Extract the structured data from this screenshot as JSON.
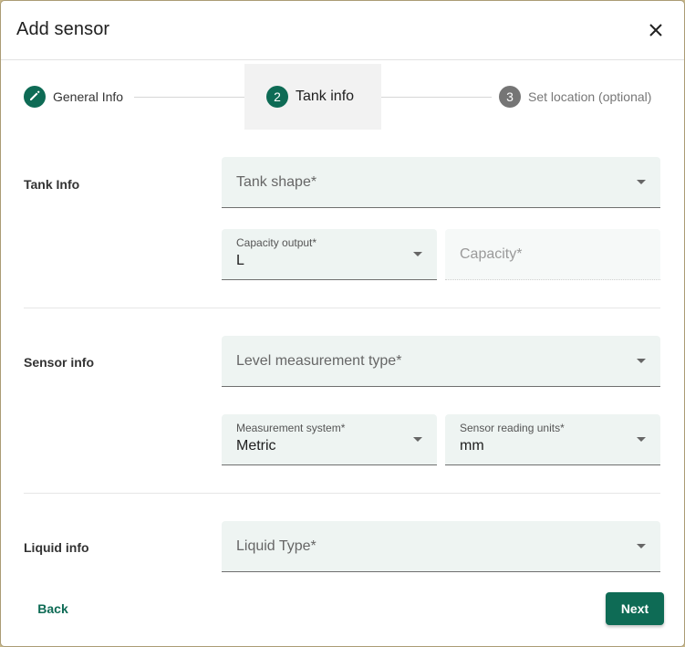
{
  "dialog": {
    "title": "Add sensor",
    "close_icon": "close-icon"
  },
  "stepper": {
    "steps": [
      {
        "number": "1",
        "label": "General Info",
        "icon": "pencil-icon",
        "state": "completed"
      },
      {
        "number": "2",
        "label": "Tank info",
        "state": "active"
      },
      {
        "number": "3",
        "label": "Set location (optional)",
        "state": "upcoming"
      }
    ]
  },
  "sections": {
    "tank": {
      "label": "Tank Info",
      "tank_shape": {
        "placeholder": "Tank shape*"
      },
      "capacity_output": {
        "label": "Capacity output*",
        "value": "L"
      },
      "capacity": {
        "placeholder": "Capacity*",
        "disabled": true
      }
    },
    "sensor": {
      "label": "Sensor info",
      "level_measurement_type": {
        "placeholder": "Level measurement type*"
      },
      "measurement_system": {
        "label": "Measurement system*",
        "value": "Metric"
      },
      "sensor_reading_units": {
        "label": "Sensor reading units*",
        "value": "mm"
      }
    },
    "liquid": {
      "label": "Liquid info",
      "liquid_type": {
        "placeholder": "Liquid Type*"
      }
    }
  },
  "actions": {
    "back_label": "Back",
    "next_label": "Next"
  },
  "colors": {
    "primary": "#0e6b55",
    "field_bg": "#eef4f2",
    "inactive_step": "#757575"
  }
}
